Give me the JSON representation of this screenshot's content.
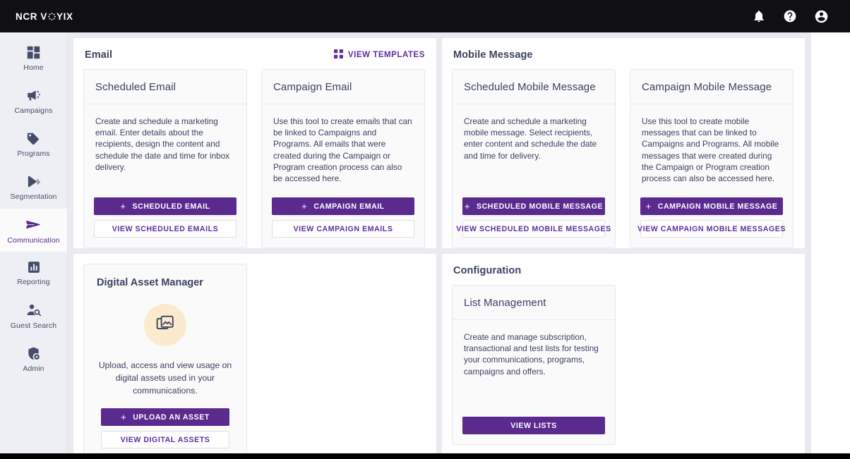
{
  "header": {
    "logo_text": "NCR V YIX",
    "logo_prefix": "NCR V",
    "logo_suffix": "YIX",
    "icons": [
      {
        "name": "notifications-icon",
        "label": "Notifications"
      },
      {
        "name": "help-icon",
        "label": "Help"
      },
      {
        "name": "account-icon",
        "label": "Account"
      }
    ],
    "background": "#101014"
  },
  "sidebar": {
    "items": [
      {
        "label": "Home",
        "icon": "home-grid-icon",
        "active": false
      },
      {
        "label": "Campaigns",
        "icon": "megaphone-icon",
        "active": false
      },
      {
        "label": "Programs",
        "icon": "tag-icon",
        "active": false
      },
      {
        "label": "Segmentation",
        "icon": "segment-arrow-icon",
        "active": false
      },
      {
        "label": "Communication",
        "icon": "send-paper-plane-icon",
        "active": true
      },
      {
        "label": "Reporting",
        "icon": "bar-chart-icon",
        "active": false
      },
      {
        "label": "Guest Search",
        "icon": "person-search-icon",
        "active": false
      },
      {
        "label": "Admin",
        "icon": "shield-gear-icon",
        "active": false
      }
    ],
    "active_color": "#5a2a8f",
    "idle_color": "#454d6b"
  },
  "theme": {
    "primary_purple": "#5a2a8f",
    "link_purple": "#5f2da0",
    "text_navy": "#3b4160",
    "card_bg": "#fafafb",
    "page_bg": "#e9ebf0",
    "accent_cream": "#fbeacd"
  },
  "panels": {
    "email": {
      "title": "Email",
      "action": {
        "label": "VIEW TEMPLATES",
        "icon": "grid-templates-icon"
      },
      "cards": [
        {
          "title": "Scheduled Email",
          "body": "Create and schedule a marketing email. Enter details about the recipients, design the content and schedule the date and time for inbox delivery.",
          "primary_button": "SCHEDULED EMAIL",
          "primary_prefix": "+",
          "secondary_button": "VIEW SCHEDULED EMAILS"
        },
        {
          "title": "Campaign Email",
          "body": "Use this tool to create emails that can be linked to Campaigns and Programs. All emails that were created during the Campaign or Program creation process can also be accessed here.",
          "primary_button": "CAMPAIGN EMAIL",
          "primary_prefix": "+",
          "secondary_button": "VIEW CAMPAIGN EMAILS"
        }
      ]
    },
    "mobile_message": {
      "title": "Mobile Message",
      "cards": [
        {
          "title": "Scheduled Mobile Message",
          "body": "Create and schedule a marketing mobile message. Select recipients, enter content and schedule the date and time for delivery.",
          "primary_button": "SCHEDULED MOBILE MESSAGE",
          "primary_prefix": "+",
          "secondary_button": "VIEW SCHEDULED MOBILE MESSAGES"
        },
        {
          "title": "Campaign Mobile Message",
          "body": "Use this tool to create mobile messages that can be linked to Campaigns and Programs. All mobile messages that were created during the Campaign or Program creation process can also be accessed here.",
          "primary_button": "CAMPAIGN MOBILE MESSAGE",
          "primary_prefix": "+",
          "secondary_button": "VIEW CAMPAIGN MOBILE MESSAGES"
        }
      ]
    },
    "digital_asset_manager": {
      "card_title": "Digital Asset Manager",
      "icon": "photo-library-icon",
      "description": "Upload, access and view usage on digital assets used in your communications.",
      "primary_button": "UPLOAD AN ASSET",
      "primary_prefix": "+",
      "secondary_button": "VIEW DIGITAL ASSETS"
    },
    "configuration": {
      "title": "Configuration",
      "card": {
        "title": "List Management",
        "body": "Create and manage subscription, transactional and test lists for testing your communications, programs, campaigns and offers.",
        "primary_button": "VIEW LISTS"
      }
    }
  }
}
